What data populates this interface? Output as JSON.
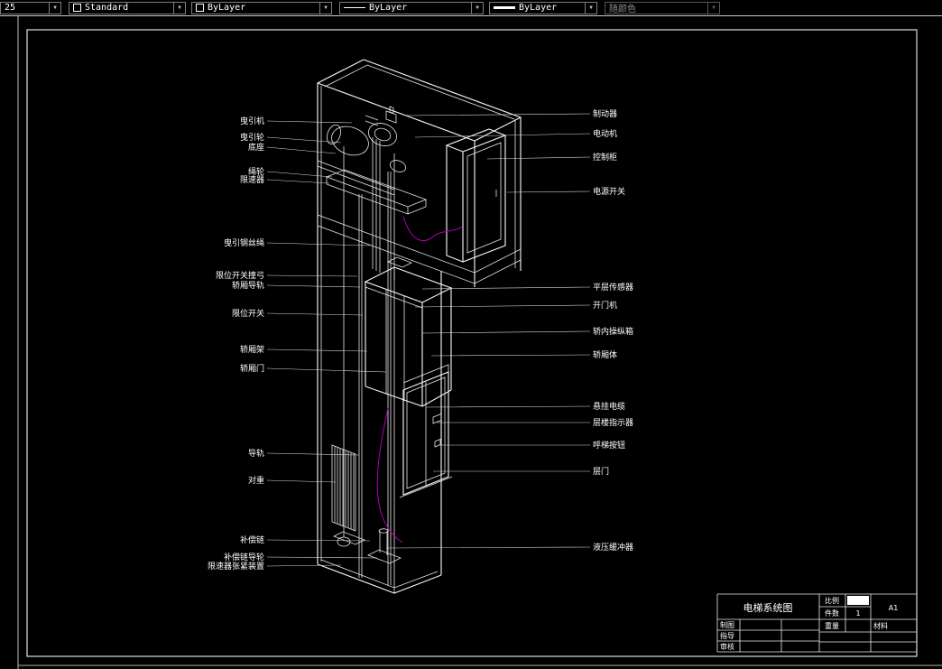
{
  "toolbar": {
    "scale_value": "25",
    "style_value": "Standard",
    "color_value": "ByLayer",
    "linetype_value": "ByLayer",
    "lineweight_value": "ByLayer",
    "plotstyle_value": "随颜色"
  },
  "labels": {
    "left": [
      "曳引机",
      "曳引轮",
      "底座",
      "绳轮",
      "限速器",
      "曳引钢丝绳",
      "限位开关撞弓",
      "轿厢导轨",
      "限位开关",
      "轿厢架",
      "轿厢门",
      "导轨",
      "对重",
      "补偿链",
      "补偿链导轮",
      "限速器张紧装置"
    ],
    "right": [
      "制动器",
      "电动机",
      "控制柜",
      "电源开关",
      "平层传感器",
      "开门机",
      "轿内操纵箱",
      "轿厢体",
      "悬挂电缆",
      "层楼指示器",
      "呼梯按钮",
      "层门",
      "液压缓冲器"
    ]
  },
  "title_block": {
    "title": "电梯系统图",
    "scale_label": "比例",
    "qty_label": "件数",
    "qty_value": "1",
    "weight_label": "重量",
    "material_label": "材料",
    "sheet_size": "A1",
    "drawn_label": "制图",
    "guide_label": "指导",
    "check_label": "审核"
  },
  "colors": {
    "canvas_bg": "#000000",
    "line": "#ffffff",
    "cable": "#c000c0"
  }
}
